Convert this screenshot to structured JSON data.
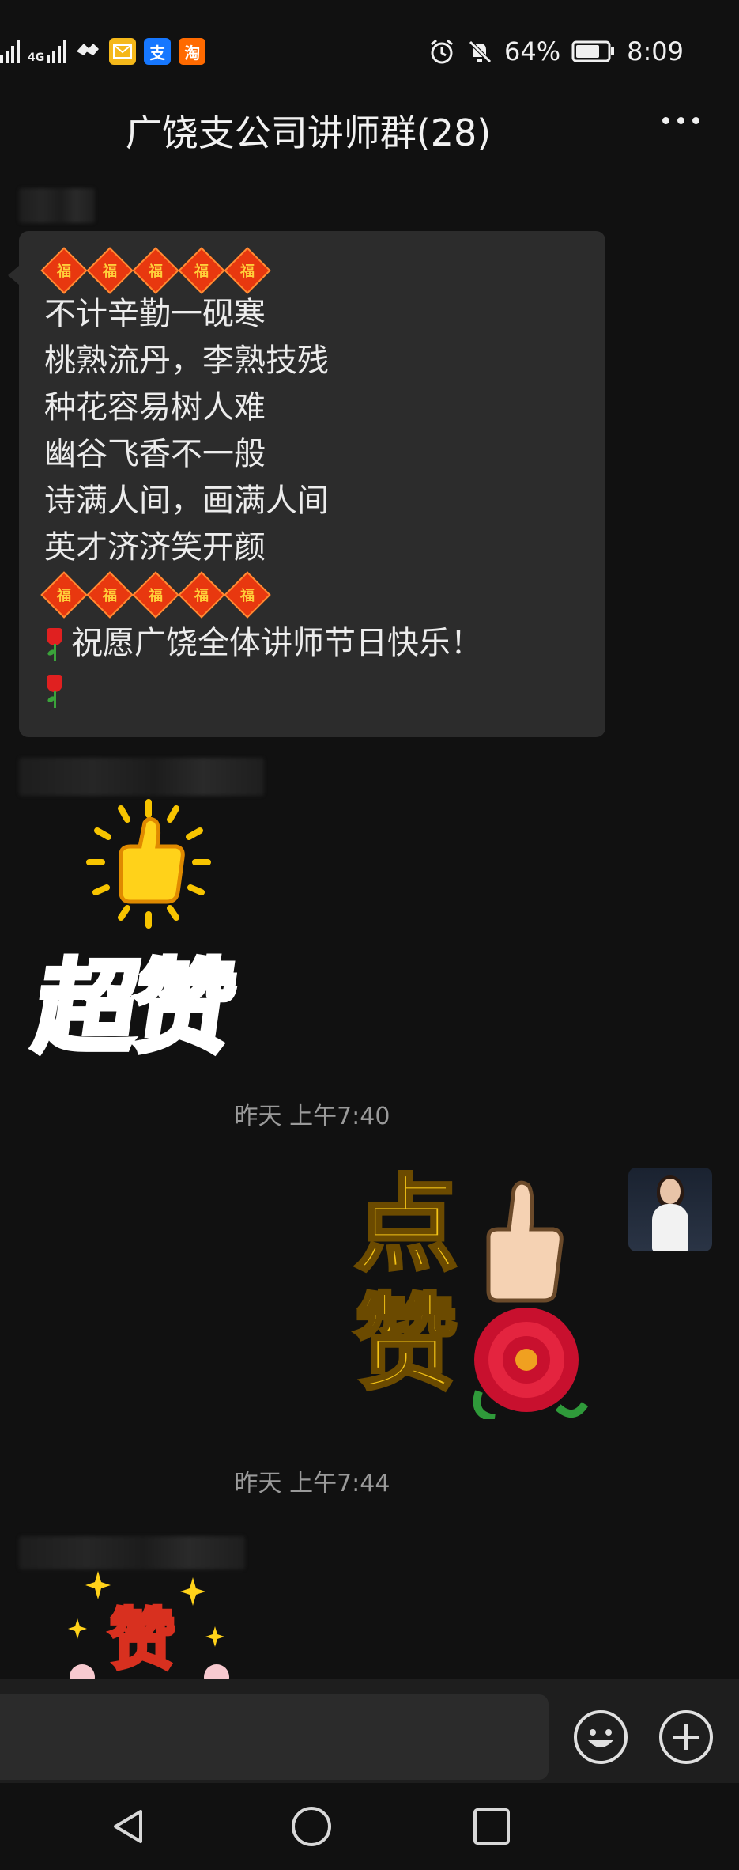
{
  "status_bar": {
    "network": "4G",
    "battery_percent": "64%",
    "time": "8:09",
    "icons": [
      "signal-icon",
      "signal-4g-icon",
      "vpn-icon",
      "mail-app-icon",
      "alipay-app-icon",
      "taobao-app-icon",
      "alarm-icon",
      "mute-icon",
      "battery-icon"
    ],
    "alipay_glyph": "支",
    "taobao_glyph": "淘"
  },
  "header": {
    "title": "广饶支公司讲师群(28)",
    "more_icon": "more-dots-icon"
  },
  "messages": [
    {
      "type": "text",
      "sender": "",
      "fu_glyph": "福",
      "lines": [
        "不计辛勤一砚寒",
        "桃熟流丹，李熟技残",
        "种花容易树人难",
        "幽谷飞香不一般",
        "诗满人间，画满人间",
        "英才济济笑开颜"
      ],
      "wish": "祝愿广饶全体讲师节日快乐！"
    },
    {
      "type": "sticker",
      "sender": "",
      "sticker_text": "超赞",
      "icon": "thumbs-up-icon"
    },
    {
      "type": "timestamp",
      "text": "昨天 上午7:40"
    },
    {
      "type": "sticker",
      "self": true,
      "sticker_text_top": "点",
      "sticker_text_bottom": "赞",
      "icon": "thumbs-up-flower-icon"
    },
    {
      "type": "timestamp",
      "text": "昨天 上午7:44"
    },
    {
      "type": "sticker",
      "sender": "",
      "sticker_text": "赞"
    }
  ],
  "input_bar": {
    "emoji_icon": "emoji-icon",
    "plus_icon": "plus-icon"
  },
  "nav_bar": {
    "icons": [
      "back-icon",
      "home-icon",
      "recents-icon"
    ]
  },
  "colors": {
    "background": "#111111",
    "bubble": "#2c2c2c",
    "fu_red": "#e8380f",
    "sticker_blue": "#1fb6e6",
    "sticker_gold": "#f3c316"
  }
}
